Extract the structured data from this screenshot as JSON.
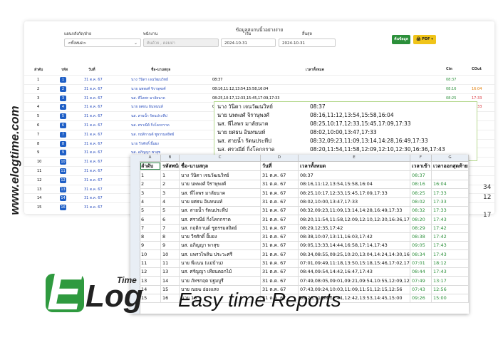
{
  "watermark": "www.elogtime.com",
  "report": {
    "title": "ข้อมูลสแกนนิ้วอย่างง่าย",
    "filters": {
      "department_label": "แผนกสังกัด/ฝ่าย",
      "department_value": "<ทั้งหมด>",
      "employee_label": "พนักงาน",
      "employee_placeholder": "ค้นด้วย , คอมม่า",
      "start_label": "เริ่ม",
      "start_value": "2024-10-31",
      "end_label": "สิ้นสุด",
      "end_value": "2024-10-31"
    },
    "buttons": {
      "search": "ค้นข้อมูล",
      "pdf": "PDF"
    },
    "columns": [
      "ลำดับ",
      "รหัส",
      "วันที่",
      "ชื่อ-นามสกุล",
      "เวลาทั้งหมด",
      "Cin",
      "COut"
    ],
    "rows": [
      {
        "no": "1",
        "id": "1",
        "date": "31 ต.ค. 67",
        "name": "นาง วันิดา เจนวัฒนวิทย์",
        "times": "08:37",
        "cin": "08:37",
        "cout": ""
      },
      {
        "no": "2",
        "id": "2",
        "date": "31 ต.ค. 67",
        "name": "นาย นพพงศ์ จิราษุพงศ์",
        "times": "08:16,11:12,13:54,15:58,16:04",
        "cin": "08:16",
        "cout": "16:04"
      },
      {
        "no": "3",
        "id": "3",
        "date": "31 ต.ค. 67",
        "name": "นส. พีไลพร มาลัยนาค",
        "times": "08:25,10:17,12:33,15:45,17:09,17:33",
        "cin": "08:25",
        "cout": "17:33"
      },
      {
        "no": "4",
        "id": "4",
        "date": "31 ต.ค. 67",
        "name": "นาย ยศธน อินทนนท์",
        "times": "08:02,10:00,13:47,17:33",
        "cin": "08:02",
        "cout": "17:33"
      },
      {
        "no": "5",
        "id": "5",
        "date": "31 ต.ค. 67",
        "name": "นส. สายน้ำ รัตนประทีป",
        "times": "",
        "cin": "",
        "cout": ""
      },
      {
        "no": "6",
        "id": "6",
        "date": "31 ต.ค. 67",
        "name": "นส. ศรวณีย์ กิ่งโคกกราด",
        "times": "",
        "cin": "",
        "cout": ""
      },
      {
        "no": "7",
        "id": "7",
        "date": "31 ต.ค. 67",
        "name": "นส. กฤติกานต์ ชูธรรมสถิตย์",
        "times": "",
        "cin": "",
        "cout": ""
      },
      {
        "no": "8",
        "id": "8",
        "date": "31 ต.ค. 67",
        "name": "นาย วีรศักดิ์ ยิ้มยง",
        "times": "",
        "cin": "",
        "cout": ""
      },
      {
        "no": "9",
        "id": "9",
        "date": "31 ต.ค. 67",
        "name": "นส. อภิญญา พาสุข",
        "times": "",
        "cin": "",
        "cout": ""
      },
      {
        "no": "10",
        "id": "10",
        "date": "31 ต.ค. 67",
        "name": "",
        "times": "",
        "cin": "",
        "cout": ""
      },
      {
        "no": "11",
        "id": "11",
        "date": "31 ต.ค. 67",
        "name": "",
        "times": "",
        "cin": "",
        "cout": ""
      },
      {
        "no": "12",
        "id": "12",
        "date": "31 ต.ค. 67",
        "name": "",
        "times": "",
        "cin": "",
        "cout": ""
      },
      {
        "no": "13",
        "id": "13",
        "date": "31 ต.ค. 67",
        "name": "",
        "times": "",
        "cin": "",
        "cout": ""
      },
      {
        "no": "14",
        "id": "14",
        "date": "31 ต.ค. 67",
        "name": "",
        "times": "",
        "cin": "",
        "cout": ""
      },
      {
        "no": "15",
        "id": "16",
        "date": "31 ต.ค. 67",
        "name": "",
        "times": "",
        "cin": "",
        "cout": ""
      }
    ],
    "right_partial": [
      "34",
      "12",
      "17"
    ]
  },
  "zoom_popup": [
    {
      "name": "นาง วันิดา เจนวัฒนวิทย์",
      "times": "08:37"
    },
    {
      "name": "นาย นพพงศ์ จิราษุพงศ์",
      "times": "08:16,11:12,13:54,15:58,16:04"
    },
    {
      "name": "นส. พีไลพร มาลัยนาค",
      "times": "08:25,10:17,12:33,15:45,17:09,17:33"
    },
    {
      "name": "นาย ยศธน อินทนนท์",
      "times": "08:02,10:00,13:47,17:33"
    },
    {
      "name": "นส. สายน้ำ รัตนประทีป",
      "times": "08:32,09:23,11:09,13:14,14:28,16:49,17:33"
    },
    {
      "name": "นส. ศรวณีย์ กิ่งโคกกราด",
      "times": "08:20,11:54,11:58,12:09,12:10,12:30,16:36,17:43"
    }
  ],
  "excel": {
    "columns": [
      "A",
      "B",
      "C",
      "D",
      "E",
      "F",
      "G"
    ],
    "header": [
      "ลำดับ",
      "รหัสพนักงาน",
      "ชื่อ-นามสกุล",
      "วันที่",
      "เวลาทั้งหมด",
      "เวลาเข้า",
      "เวลาออกสุดท้าย"
    ],
    "rows": [
      [
        "1",
        "1",
        "นาง วันิดา เจนวัฒนวิทย์",
        "31 ต.ค. 67",
        "08:37",
        "08:37",
        ""
      ],
      [
        "2",
        "2",
        "นาย นพพงศ์ จิราษุพงศ์",
        "31 ต.ค. 67",
        "08:16,11:12,13:54,15:58,16:04",
        "08:16",
        "16:04"
      ],
      [
        "3",
        "3",
        "นส. พีไลพร มาลัยนาค",
        "31 ต.ค. 67",
        "08:25,10:17,12:33,15:45,17:09,17:33",
        "08:25",
        "17:33"
      ],
      [
        "4",
        "4",
        "นาย ยศธน อินทนนท์",
        "31 ต.ค. 67",
        "08:02,10:00,13:47,17:33",
        "08:02",
        "17:33"
      ],
      [
        "5",
        "5",
        "นส. สายน้ำ รัตนประทีป",
        "31 ต.ค. 67",
        "08:32,09:23,11:09,13:14,14:28,16:49,17:33",
        "08:32",
        "17:33"
      ],
      [
        "6",
        "6",
        "นส. ศรวณีย์ กิ่งโคกกราด",
        "31 ต.ค. 67",
        "08:20,11:54,11:58,12:09,12:10,12:30,16:36,17:43",
        "08:20",
        "17:43"
      ],
      [
        "7",
        "7",
        "นส. กฤติกานต์ ชูธรรมสถิตย์",
        "31 ต.ค. 67",
        "08:29,12:35,17:42",
        "08:29",
        "17:42"
      ],
      [
        "8",
        "8",
        "นาย วีรศักดิ์ ยิ้มยง",
        "31 ต.ค. 67",
        "08:38,10:07,13:11,16:03,17:42",
        "08:38",
        "17:42"
      ],
      [
        "9",
        "9",
        "นส. อภิญญา พาสุข",
        "31 ต.ค. 67",
        "09:05,13:33,14:44,16:58,17:14,17:43",
        "09:05",
        "17:43"
      ],
      [
        "10",
        "10",
        "นส. แพรวไพลิน ประวะศรี",
        "31 ต.ค. 67",
        "08:34,08:55,09:25,10:20,13:04,14:24,14:30,16:4",
        "08:34",
        "17:43"
      ],
      [
        "11",
        "11",
        "นาย พีแนน (แม่บ้าน)",
        "31 ต.ค. 67",
        "07:01,09:49,11:18,13:50,15:18,15:46,17:02,17:1",
        "07:01",
        "18:12"
      ],
      [
        "12",
        "13",
        "นส. ศรัญญา เทียนดอกไม้",
        "31 ต.ค. 67",
        "08:44,09:54,14:42,16:47,17:43",
        "08:44",
        "17:43"
      ],
      [
        "13",
        "14",
        "นาย ภัทรกฤต ปฐมบูรี",
        "31 ต.ค. 67",
        "07:49,08:05,09:01,09:21,09:54,10:55,12:09,12:2",
        "07:49",
        "13:17"
      ],
      [
        "14",
        "15",
        "นาย ณยฆ อ่องแสง",
        "31 ต.ค. 67",
        "07:43,09:24,10:03,11:09,11:51,12:15,12:56",
        "07:43",
        "12:56"
      ],
      [
        "15",
        "16",
        "นาย 16",
        "31 ต.ค. 67",
        "09:26,11:58,12:41,12:42,13:53,14:45,15:00",
        "09:26",
        "15:00"
      ]
    ]
  },
  "branding": {
    "logo_letter": "E",
    "logo_word": "Log",
    "logo_superscript": "Time",
    "tagline": "Easy time Reports"
  },
  "colors": {
    "accent_green": "#2b8f3a",
    "badge_blue": "#1f5fc6",
    "orange": "#e07a00",
    "red": "#d9363e"
  }
}
